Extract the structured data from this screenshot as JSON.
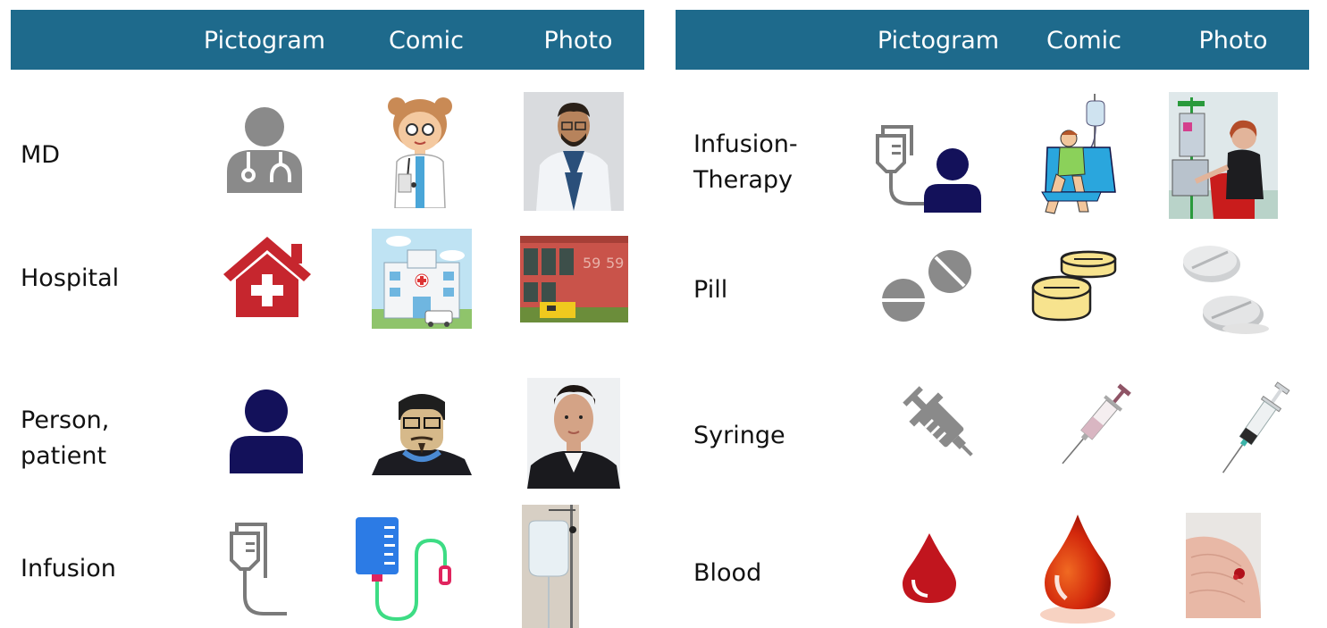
{
  "left_table": {
    "columns": [
      "Pictogram",
      "Comic",
      "Photo"
    ],
    "rows": [
      {
        "label": "MD",
        "icons": [
          "doctor-pictogram",
          "doctor-comic",
          "doctor-photo"
        ]
      },
      {
        "label": "Hospital",
        "icons": [
          "hospital-pictogram",
          "hospital-comic",
          "hospital-photo"
        ]
      },
      {
        "label": "Person, patient",
        "icons": [
          "person-pictogram",
          "person-comic",
          "person-photo"
        ]
      },
      {
        "label": "Infusion",
        "icons": [
          "infusion-pictogram",
          "infusion-comic",
          "infusion-photo"
        ]
      }
    ]
  },
  "right_table": {
    "columns": [
      "Pictogram",
      "Comic",
      "Photo"
    ],
    "rows": [
      {
        "label": "Infusion-Therapy",
        "icons": [
          "infusion-therapy-pictogram",
          "infusion-therapy-comic",
          "infusion-therapy-photo"
        ]
      },
      {
        "label": "Pill",
        "icons": [
          "pill-pictogram",
          "pill-comic",
          "pill-photo"
        ]
      },
      {
        "label": "Syringe",
        "icons": [
          "syringe-pictogram",
          "syringe-comic",
          "syringe-photo"
        ]
      },
      {
        "label": "Blood",
        "icons": [
          "blood-pictogram",
          "blood-comic",
          "blood-photo"
        ]
      }
    ]
  },
  "colors": {
    "header": "#1e6a8c",
    "header_text": "#ffffff",
    "pictogram_gray": "#8a8a8a",
    "navy": "#13115a",
    "red": "#c6262e"
  }
}
